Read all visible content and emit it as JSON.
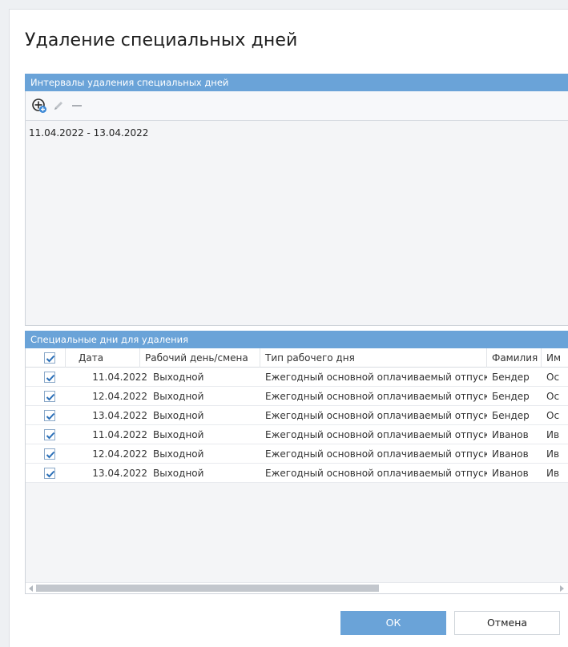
{
  "dialog": {
    "title": "Удаление специальных дней"
  },
  "intervals": {
    "header": "Интервалы удаления специальных дней",
    "toolbar": {
      "add_icon": "add-interval-icon",
      "edit_icon": "edit-pencil-icon",
      "remove_icon": "remove-minus-icon"
    },
    "items": [
      "11.04.2022 - 13.04.2022"
    ]
  },
  "special_days": {
    "header": "Специальные дни для удаления",
    "columns": {
      "date": "Дата",
      "workday": "Рабочий день/смена",
      "day_type": "Тип рабочего дня",
      "last_name": "Фамилия",
      "first_name": "Им"
    },
    "rows": [
      {
        "checked": true,
        "date": "11.04.2022",
        "workday": "Выходной",
        "day_type": "Ежегодный основной оплачиваемый отпуск",
        "last_name": "Бендер",
        "first_name": "Ос"
      },
      {
        "checked": true,
        "date": "12.04.2022",
        "workday": "Выходной",
        "day_type": "Ежегодный основной оплачиваемый отпуск",
        "last_name": "Бендер",
        "first_name": "Ос"
      },
      {
        "checked": true,
        "date": "13.04.2022",
        "workday": "Выходной",
        "day_type": "Ежегодный основной оплачиваемый отпуск",
        "last_name": "Бендер",
        "first_name": "Ос"
      },
      {
        "checked": true,
        "date": "11.04.2022",
        "workday": "Выходной",
        "day_type": "Ежегодный основной оплачиваемый отпуск",
        "last_name": "Иванов",
        "first_name": "Ив"
      },
      {
        "checked": true,
        "date": "12.04.2022",
        "workday": "Выходной",
        "day_type": "Ежегодный основной оплачиваемый отпуск",
        "last_name": "Иванов",
        "first_name": "Ив"
      },
      {
        "checked": true,
        "date": "13.04.2022",
        "workday": "Выходной",
        "day_type": "Ежегодный основной оплачиваемый отпуск",
        "last_name": "Иванов",
        "first_name": "Ив"
      }
    ]
  },
  "buttons": {
    "ok": "ОК",
    "cancel": "Отмена"
  },
  "colors": {
    "accent": "#6aa3d8",
    "check": "#2a6fb8"
  }
}
